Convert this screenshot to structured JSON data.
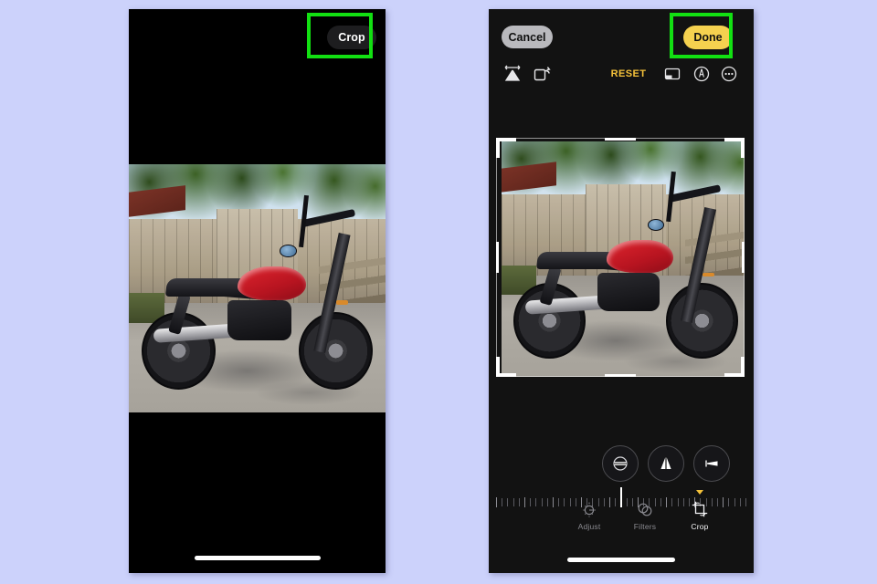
{
  "page": {
    "background_color": "#ccd2fb",
    "highlight_color": "#12e012"
  },
  "left_phone": {
    "name": "photo-viewer-screen",
    "background_color": "#000000",
    "crop_button": {
      "label": "Crop",
      "icon": "crop-button",
      "highlighted": true
    },
    "photo": {
      "alt": "Red Triumph motorcycle parked on pavement in front of a wooden fence",
      "letterboxed": true
    },
    "home_indicator": "home-indicator"
  },
  "right_phone": {
    "name": "photo-crop-editor-screen",
    "background_color": "#121212",
    "topbar": {
      "cancel_label": "Cancel",
      "done_label": "Done",
      "done_color": "#f5d14f",
      "cancel_color": "#b9b9bd",
      "done_highlighted": true
    },
    "toolbar": {
      "flip_icon": "flip-horizontal-icon",
      "rotate_icon": "rotate-icon",
      "reset_label": "RESET",
      "reset_color": "#f4c13a",
      "aspect_icon": "aspect-ratio-icon",
      "auto_icon": "auto-enhance-icon",
      "more_icon": "more-options-icon"
    },
    "crop_frame": {
      "label": "crop-frame",
      "handles": [
        "top-left",
        "top-right",
        "bottom-left",
        "bottom-right",
        "top",
        "bottom",
        "left",
        "right"
      ]
    },
    "perspective_buttons": [
      {
        "name": "straighten-button",
        "icon": "straighten-icon"
      },
      {
        "name": "vertical-perspective-button",
        "icon": "vertical-perspective-icon"
      },
      {
        "name": "horizontal-perspective-button",
        "icon": "horizontal-perspective-icon"
      }
    ],
    "ruler": {
      "name": "straighten-slider",
      "value": 0,
      "indicator_color": "#ffffff",
      "tick_count": 45
    },
    "tabs": [
      {
        "label": "Adjust",
        "icon": "adjust-icon",
        "active": false
      },
      {
        "label": "Filters",
        "icon": "filters-icon",
        "active": false
      },
      {
        "label": "Crop",
        "icon": "crop-icon",
        "active": true
      }
    ],
    "home_indicator": "home-indicator"
  }
}
